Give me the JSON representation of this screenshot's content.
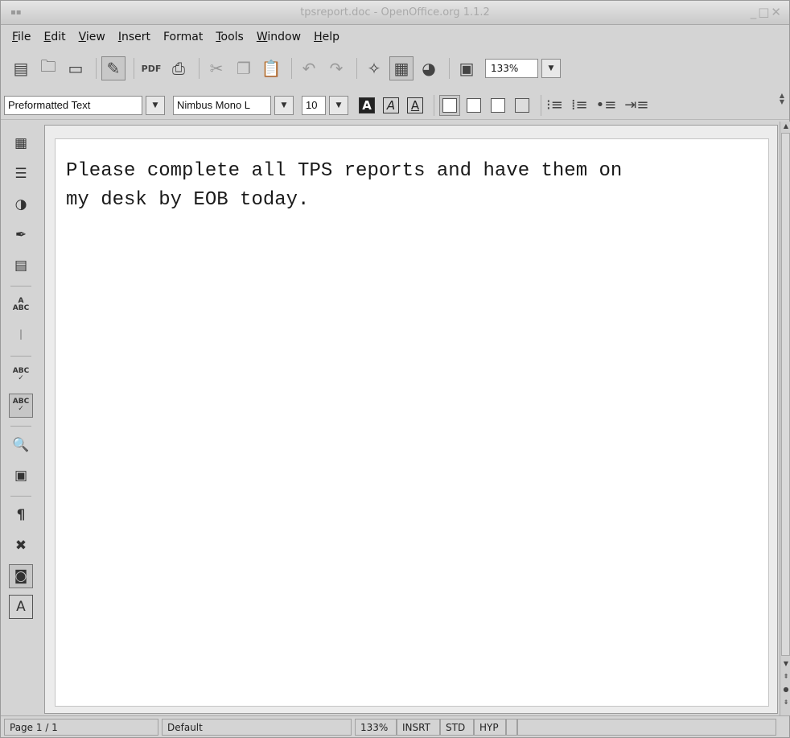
{
  "window": {
    "title": "tpsreport.doc - OpenOffice.org 1.1.2"
  },
  "menubar": {
    "items": [
      {
        "label": "File",
        "underline": "F",
        "rest": "ile"
      },
      {
        "label": "Edit",
        "underline": "E",
        "rest": "dit"
      },
      {
        "label": "View",
        "underline": "V",
        "rest": "iew"
      },
      {
        "label": "Insert",
        "underline": "I",
        "rest": "nsert"
      },
      {
        "label": "Format",
        "underline": "",
        "rest": "Format"
      },
      {
        "label": "Tools",
        "underline": "T",
        "rest": "ools"
      },
      {
        "label": "Window",
        "underline": "W",
        "rest": "indow"
      },
      {
        "label": "Help",
        "underline": "H",
        "rest": "elp"
      }
    ]
  },
  "toolbar": {
    "zoom": "133%"
  },
  "format_bar": {
    "paragraph_style": "Preformatted Text",
    "font_name": "Nimbus Mono L",
    "font_size": "10",
    "bold_glyph": "A",
    "italic_glyph": "A",
    "underline_glyph": "A"
  },
  "document": {
    "line1": "Please complete all TPS reports and have them on",
    "line2": "my desk by EOB today."
  },
  "statusbar": {
    "page": "Page 1 / 1",
    "page_style": "Default",
    "zoom": "133%",
    "insert_mode": "INSRT",
    "selection_mode": "STD",
    "hyperlink_mode": "HYP"
  },
  "icons": {
    "left_toolbar": [
      "insert-table-icon",
      "insert-fields-icon",
      "insert-objects-icon",
      "draw-functions-icon",
      "form-functions-icon",
      "edit-autotext-icon",
      "text-cursor-icon",
      "spellcheck-icon",
      "autospellcheck-icon",
      "find-replace-icon",
      "data-sources-icon",
      "nonprinting-chars-icon",
      "graphics-off-icon",
      "online-layout-icon",
      "direct-cursor-icon"
    ]
  }
}
